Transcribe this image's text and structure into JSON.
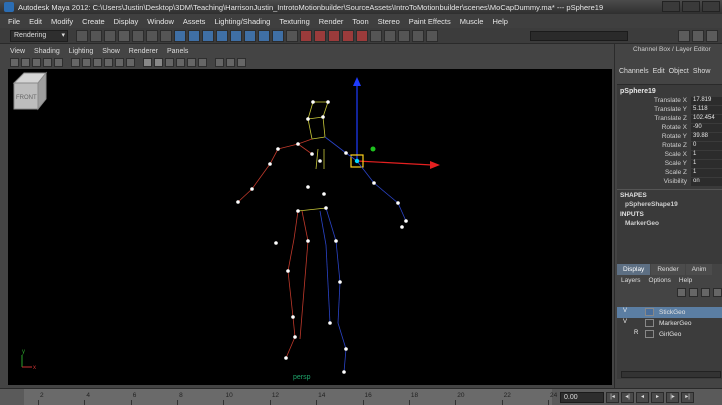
{
  "window": {
    "title": "Autodesk Maya 2012: C:\\Users\\Justin\\Desktop\\3DM\\Teaching\\HarrisonJustin_IntrotoMotionbuilder\\SourceAssets\\IntroToMotionbuilder\\scenes\\MoCapDummy.ma*   ---   pSphere19"
  },
  "menubar": {
    "items": [
      "File",
      "Edit",
      "Modify",
      "Create",
      "Display",
      "Window",
      "Assets",
      "Lighting/Shading",
      "Texturing",
      "Render",
      "Toon",
      "Stereo",
      "Paint Effects",
      "Muscle",
      "Help"
    ]
  },
  "statusline": {
    "mode": "Rendering"
  },
  "panel_menu": {
    "items": [
      "View",
      "Shading",
      "Lighting",
      "Show",
      "Renderer",
      "Panels"
    ]
  },
  "viewport": {
    "camera_label": "persp",
    "viewcube_label": "FRONT",
    "axis_x": "x",
    "axis_y": "y"
  },
  "channel_box": {
    "header": "Channel Box / Layer Editor",
    "tabs": [
      "Channels",
      "Edit",
      "Object",
      "Show"
    ],
    "object_name": "pSphere19",
    "attributes": [
      {
        "label": "Translate X",
        "value": "17.819"
      },
      {
        "label": "Translate Y",
        "value": "5.118"
      },
      {
        "label": "Translate Z",
        "value": "102.454"
      },
      {
        "label": "Rotate X",
        "value": "-90"
      },
      {
        "label": "Rotate Y",
        "value": "39.88"
      },
      {
        "label": "Rotate Z",
        "value": "0"
      },
      {
        "label": "Scale X",
        "value": "1"
      },
      {
        "label": "Scale Y",
        "value": "1"
      },
      {
        "label": "Scale Z",
        "value": "1"
      },
      {
        "label": "Visibility",
        "value": "on"
      }
    ],
    "shapes_header": "SHAPES",
    "shape_name": "pSphereShape19",
    "inputs_header": "INPUTS",
    "input_name": "MarkerGeo"
  },
  "layer_editor": {
    "tabs": [
      "Display",
      "Render",
      "Anim"
    ],
    "menu": [
      "Layers",
      "Options",
      "Help"
    ],
    "layers": [
      {
        "vis": "V",
        "type": "",
        "name": "StickGeo",
        "color": "#4a6f9c"
      },
      {
        "vis": "V",
        "type": "",
        "name": "MarkerGeo",
        "color": "#3c3c3c"
      },
      {
        "vis": "",
        "type": "R",
        "name": "GirlGeo",
        "color": "#3c3c3c"
      }
    ]
  },
  "timeline": {
    "ticks": [
      "2",
      "4",
      "6",
      "8",
      "10",
      "12",
      "14",
      "16",
      "18",
      "20",
      "22",
      "24"
    ],
    "current_time": "0.00"
  }
}
